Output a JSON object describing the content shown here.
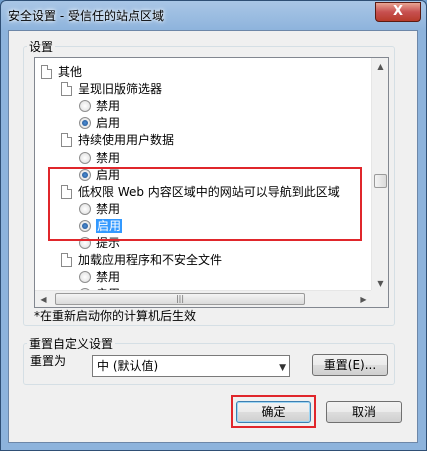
{
  "window": {
    "title": "安全设置 - 受信任的站点区域",
    "close_glyph": "X"
  },
  "settings": {
    "group_label": "设置",
    "tree": [
      {
        "type": "category",
        "label": "其他"
      },
      {
        "type": "setting",
        "label": "呈现旧版筛选器"
      },
      {
        "type": "option",
        "label": "禁用",
        "checked": false
      },
      {
        "type": "option",
        "label": "启用",
        "checked": true
      },
      {
        "type": "setting",
        "label": "持续使用用户数据"
      },
      {
        "type": "option",
        "label": "禁用",
        "checked": false
      },
      {
        "type": "option",
        "label": "启用",
        "checked": true
      },
      {
        "type": "setting",
        "label": "低权限 Web 内容区域中的网站可以导航到此区域"
      },
      {
        "type": "option",
        "label": "禁用",
        "checked": false
      },
      {
        "type": "option",
        "label": "启用",
        "checked": true,
        "selected": true
      },
      {
        "type": "option",
        "label": "提示",
        "checked": false
      },
      {
        "type": "setting",
        "label": "加载应用程序和不安全文件"
      },
      {
        "type": "option",
        "label": "禁用",
        "checked": false
      },
      {
        "type": "option",
        "label": "启用",
        "checked": true
      }
    ],
    "note": "*在重新启动你的计算机后生效"
  },
  "reset": {
    "group_label": "重置自定义设置",
    "reset_to_label": "重置为",
    "level_value": "中 (默认值)",
    "reset_button": "重置(E)..."
  },
  "buttons": {
    "ok": "确定",
    "cancel": "取消"
  },
  "colors": {
    "highlight": "#e0262b",
    "selection": "#3399ff"
  }
}
